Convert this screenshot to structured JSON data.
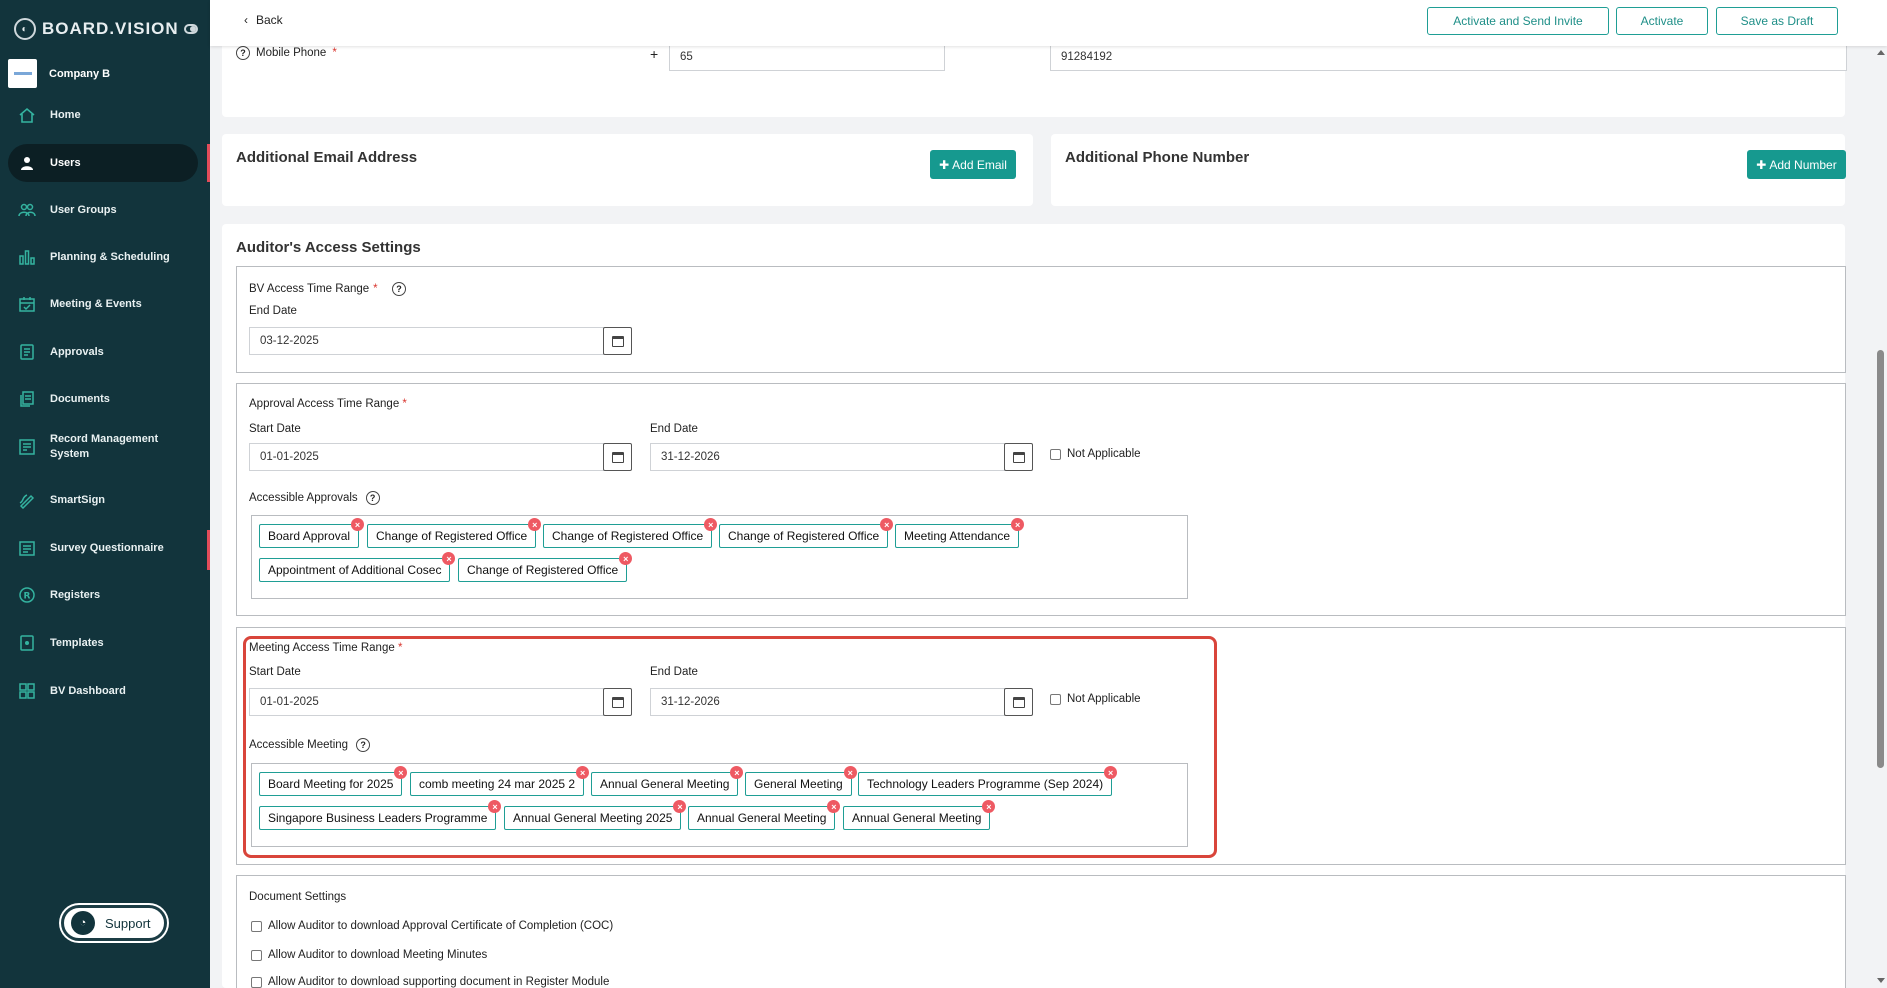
{
  "sidebar": {
    "brand": "BOARD.VISION",
    "company": "Company B",
    "items": [
      {
        "label": "Home",
        "icon": "home-icon"
      },
      {
        "label": "Users",
        "icon": "user-icon"
      },
      {
        "label": "User Groups",
        "icon": "user-group-icon"
      },
      {
        "label": "Planning & Scheduling",
        "icon": "chart-icon"
      },
      {
        "label": "Meeting & Events",
        "icon": "calendar-icon"
      },
      {
        "label": "Approvals",
        "icon": "approval-icon"
      },
      {
        "label": "Documents",
        "icon": "document-icon"
      },
      {
        "label": "Record Management System",
        "icon": "record-icon"
      },
      {
        "label": "SmartSign",
        "icon": "pen-icon"
      },
      {
        "label": "Survey Questionnaire",
        "icon": "survey-icon"
      },
      {
        "label": "Registers",
        "icon": "registers-icon"
      },
      {
        "label": "Templates",
        "icon": "template-icon"
      },
      {
        "label": "BV Dashboard",
        "icon": "dashboard-icon"
      }
    ],
    "support": "Support"
  },
  "topbar": {
    "back": "Back",
    "activate_send": "Activate and Send Invite",
    "activate": "Activate",
    "save_draft": "Save as Draft"
  },
  "phone": {
    "label": "Mobile Phone",
    "plus": "+",
    "country_code": "65",
    "number": "91284192"
  },
  "additional": {
    "email_title": "Additional Email Address",
    "email_btn": "Add Email",
    "phone_title": "Additional Phone Number",
    "phone_btn": "Add Number"
  },
  "access": {
    "title": "Auditor's Access Settings",
    "bv": {
      "label": "BV Access Time Range",
      "end_label": "End Date",
      "end_value": "03-12-2025"
    },
    "approval": {
      "label": "Approval Access Time Range",
      "start_label": "Start Date",
      "start_value": "01-01-2025",
      "end_label": "End Date",
      "end_value": "31-12-2026",
      "na_label": "Not Applicable",
      "accessible_label": "Accessible Approvals",
      "tags": [
        "Board Approval",
        "Change of Registered Office",
        "Change of Registered Office",
        "Change of Registered Office",
        "Meeting Attendance",
        "Appointment of Additional Cosec",
        "Change of Registered Office"
      ]
    },
    "meeting": {
      "label": "Meeting Access Time Range",
      "start_label": "Start Date",
      "start_value": "01-01-2025",
      "end_label": "End Date",
      "end_value": "31-12-2026",
      "na_label": "Not Applicable",
      "accessible_label": "Accessible Meeting",
      "tags": [
        "Board Meeting for 2025",
        "comb meeting 24 mar 2025 2",
        "Annual General Meeting",
        "General Meeting",
        "Technology Leaders Programme (Sep 2024)",
        "Singapore Business Leaders Programme",
        "Annual General Meeting 2025",
        "Annual General Meeting",
        "Annual General Meeting"
      ]
    },
    "documents": {
      "label": "Document Settings",
      "options": [
        "Allow Auditor to download Approval Certificate of Completion (COC)",
        "Allow Auditor to download Meeting Minutes",
        "Allow Auditor to download supporting document in Register Module"
      ]
    }
  },
  "colors": {
    "sidebar": "#12343c",
    "accent": "#16998f",
    "remove": "#ee5a63",
    "highlight": "#d9453b"
  }
}
